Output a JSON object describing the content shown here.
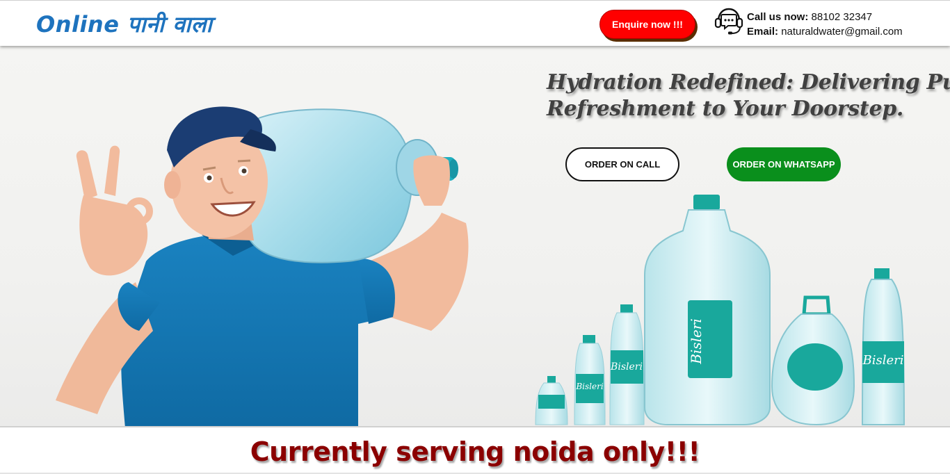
{
  "header": {
    "logo": "Online पानी वाला",
    "enquire_label": "Enquire now !!!",
    "call_label": "Call us now:",
    "call_number": "88102 32347",
    "email_label": "Email:",
    "email_value": "naturaldwater@gmail.com",
    "contact_icon": "headset-chat-icon"
  },
  "hero": {
    "tagline_line1": "Hydration Redefined: Delivering Pure",
    "tagline_line2": "Refreshment to Your Doorstep.",
    "order_call_label": "ORDER ON CALL",
    "order_whatsapp_label": "ORDER ON WHATSAPP",
    "bottle_brand": "Bisleri"
  },
  "banner": {
    "serving_text": "Currently serving noida only!!!"
  },
  "colors": {
    "brand_blue": "#1e73be",
    "enquire_red": "#ff0000",
    "whatsapp_green": "#0a8f1c",
    "serving_red": "#8b0000"
  }
}
